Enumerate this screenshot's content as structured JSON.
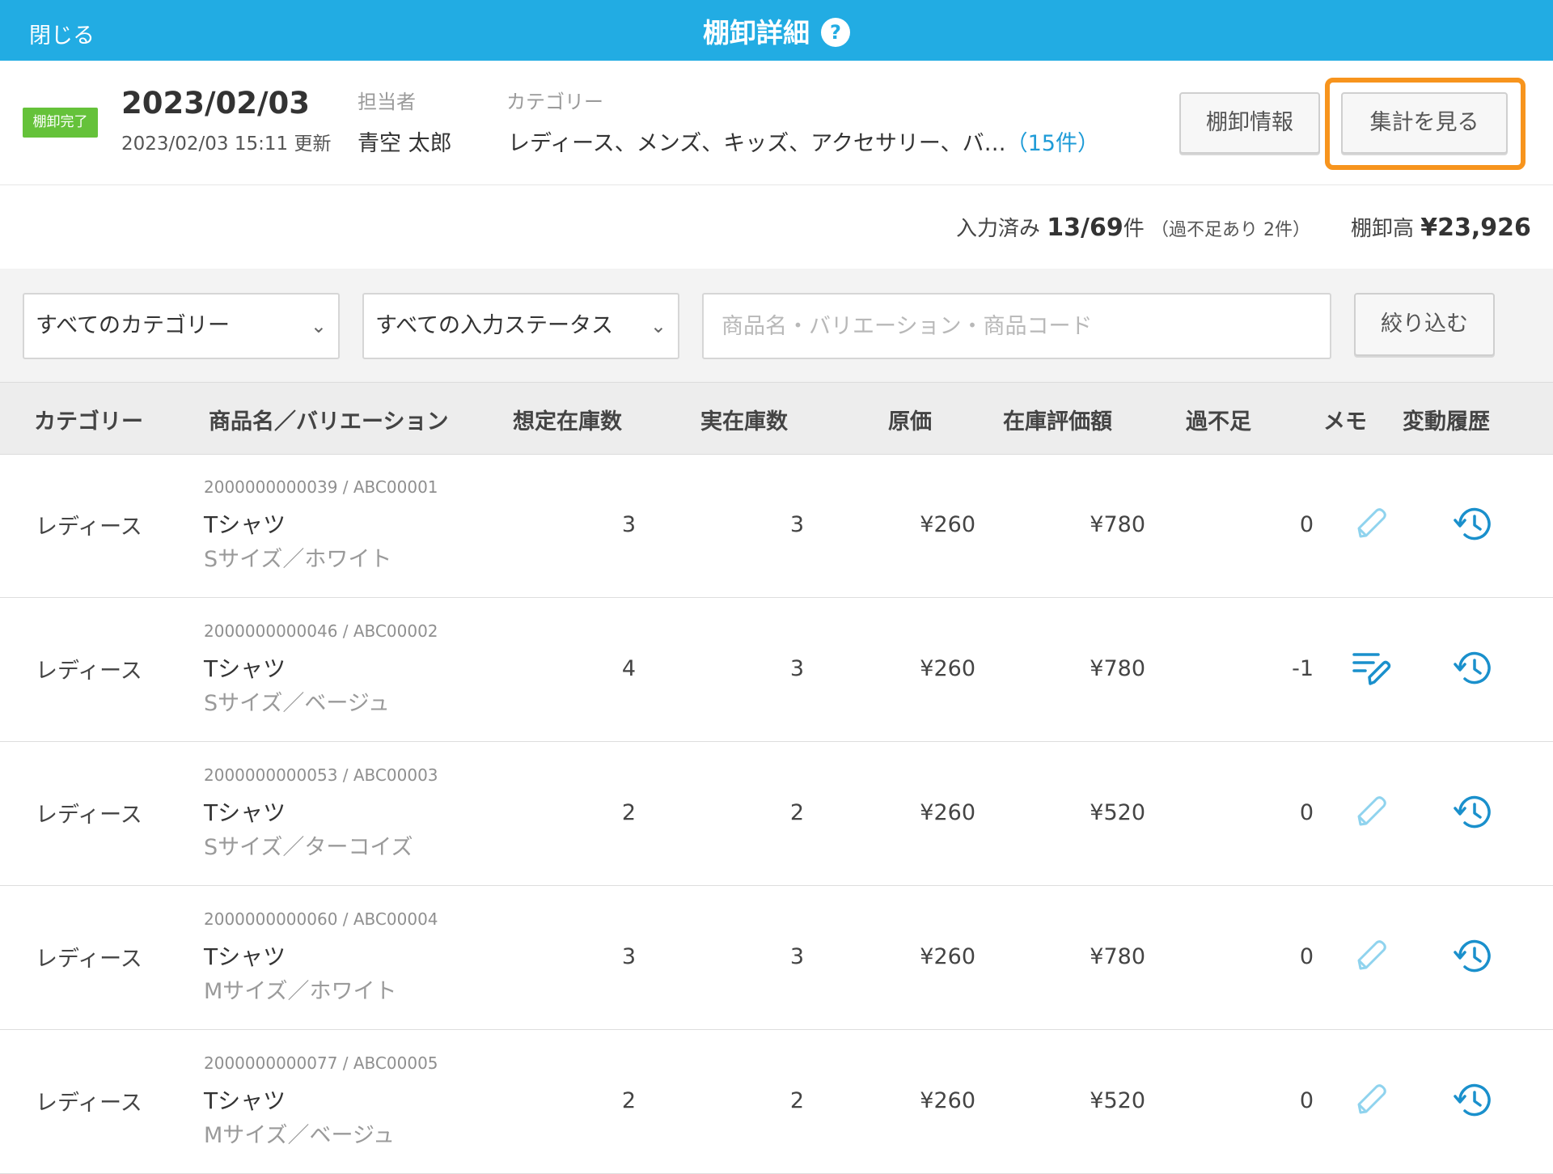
{
  "header": {
    "close_label": "閉じる",
    "title": "棚卸詳細",
    "help_glyph": "?",
    "accent_color": "#22ace3"
  },
  "info": {
    "status_badge": "棚卸完了",
    "date": "2023/02/03",
    "updated": "2023/02/03 15:11 更新",
    "assignee_label": "担当者",
    "assignee": "青空 太郎",
    "category_label": "カテゴリー",
    "categories": "レディース、メンズ、キッズ、アクセサリー、バ…",
    "category_count": "（15件）",
    "btn_info": "棚卸情報",
    "btn_summary": "集計を見る",
    "highlight_color": "#f7941d"
  },
  "summary": {
    "input_label": "入力済み",
    "input_value": "13/69",
    "input_unit": "件",
    "shortage_note": "（過不足あり 2件）",
    "total_label": "棚卸高",
    "total_value": "¥23,926"
  },
  "filters": {
    "category_select": "すべてのカテゴリー",
    "status_select": "すべての入力ステータス",
    "search_placeholder": "商品名・バリエーション・商品コード",
    "filter_button": "絞り込む"
  },
  "table": {
    "headers": [
      "カテゴリー",
      "商品名／バリエーション",
      "想定在庫数",
      "実在庫数",
      "原価",
      "在庫評価額",
      "過不足",
      "メモ",
      "変動履歴"
    ],
    "rows": [
      {
        "category": "レディース",
        "code": "2000000000039 / ABC00001",
        "name": "Tシャツ",
        "variation": "Sサイズ／ホワイト",
        "expected": "3",
        "actual": "3",
        "cost": "¥260",
        "value": "¥780",
        "diff": "0",
        "memo_icon": "pencil-icon-inactive"
      },
      {
        "category": "レディース",
        "code": "2000000000046 / ABC00002",
        "name": "Tシャツ",
        "variation": "Sサイズ／ベージュ",
        "expected": "4",
        "actual": "3",
        "cost": "¥260",
        "value": "¥780",
        "diff": "-1",
        "memo_icon": "memo-edit-icon-active"
      },
      {
        "category": "レディース",
        "code": "2000000000053 / ABC00003",
        "name": "Tシャツ",
        "variation": "Sサイズ／ターコイズ",
        "expected": "2",
        "actual": "2",
        "cost": "¥260",
        "value": "¥520",
        "diff": "0",
        "memo_icon": "pencil-icon-inactive"
      },
      {
        "category": "レディース",
        "code": "2000000000060 / ABC00004",
        "name": "Tシャツ",
        "variation": "Mサイズ／ホワイト",
        "expected": "3",
        "actual": "3",
        "cost": "¥260",
        "value": "¥780",
        "diff": "0",
        "memo_icon": "pencil-icon-inactive"
      },
      {
        "category": "レディース",
        "code": "2000000000077 / ABC00005",
        "name": "Tシャツ",
        "variation": "Mサイズ／ベージュ",
        "expected": "2",
        "actual": "2",
        "cost": "¥260",
        "value": "¥520",
        "diff": "0",
        "memo_icon": "pencil-icon-inactive"
      }
    ]
  }
}
